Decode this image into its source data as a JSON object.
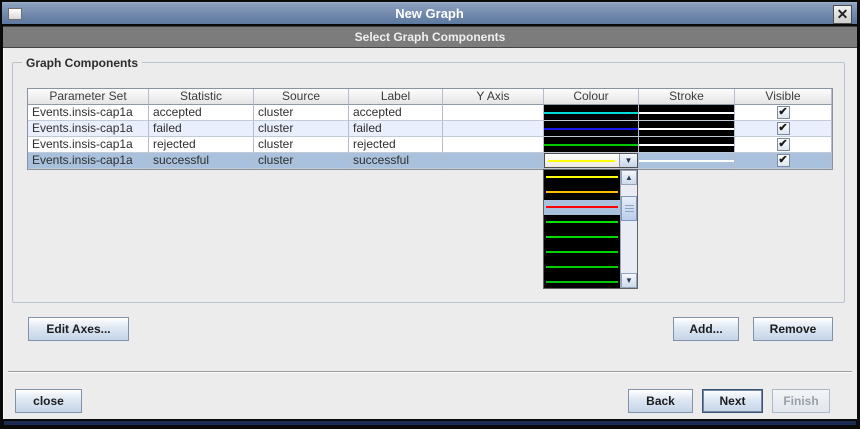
{
  "window": {
    "title": "New Graph",
    "subtitle": "Select Graph Components"
  },
  "icons": {
    "close": "✕",
    "dropdown_arrow": "▼",
    "scroll_up": "▲",
    "scroll_down": "▼",
    "check": "✔"
  },
  "group_title": "Graph Components",
  "table": {
    "columns": [
      "Parameter Set",
      "Statistic",
      "Source",
      "Label",
      "Y Axis",
      "Colour",
      "Stroke",
      "Visible"
    ],
    "rows": [
      {
        "parameter_set": "Events.insis-cap1a",
        "statistic": "accepted",
        "source": "cluster",
        "label": "accepted",
        "y_axis": "",
        "colour": "#00dcdc",
        "stroke": "#ffffff",
        "visible": true,
        "selected": false
      },
      {
        "parameter_set": "Events.insis-cap1a",
        "statistic": "failed",
        "source": "cluster",
        "label": "failed",
        "y_axis": "",
        "colour": "#1a1af0",
        "stroke": "#ffffff",
        "visible": true,
        "selected": false
      },
      {
        "parameter_set": "Events.insis-cap1a",
        "statistic": "rejected",
        "source": "cluster",
        "label": "rejected",
        "y_axis": "",
        "colour": "#00c800",
        "stroke": "#ffffff",
        "visible": true,
        "selected": false
      },
      {
        "parameter_set": "Events.insis-cap1a",
        "statistic": "successful",
        "source": "cluster",
        "label": "successful",
        "y_axis": "",
        "colour": "#ffff00",
        "stroke": "#ffffff",
        "visible": true,
        "selected": true
      }
    ]
  },
  "colour_dropdown": {
    "open_for_row": 3,
    "selected_index": 2,
    "selection_background": "#aac1dd",
    "items": [
      "#ffff00",
      "#ffbe00",
      "#ff0000",
      "#00e400",
      "#00dc00",
      "#00d400",
      "#00cc00",
      "#00c400"
    ]
  },
  "buttons": {
    "edit_axes": "Edit Axes...",
    "add": "Add...",
    "remove": "Remove",
    "close": "close",
    "back": "Back",
    "next": "Next",
    "finish": "Finish"
  },
  "colors": {
    "selection": "#aac1dd",
    "alt_row": "#e9effc",
    "titlebar_top": "#8da3c1",
    "titlebar_bottom": "#5d78a0",
    "subtitle_bg": "#7c7c7c",
    "dialog_bg": "#ececec",
    "frame_accent": "#1c2a54"
  }
}
